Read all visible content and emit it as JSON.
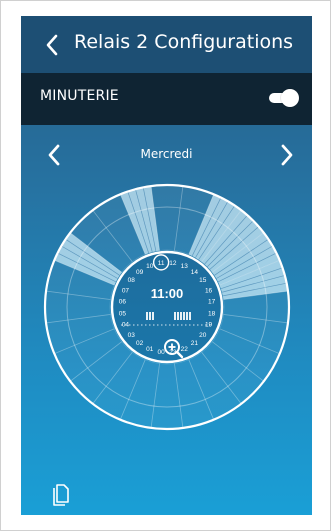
{
  "header": {
    "title": "Relais 2 Configurations",
    "back_icon": "chevron-left-icon"
  },
  "timer": {
    "label": "MINUTERIE",
    "enabled": true
  },
  "day_selector": {
    "day": "Mercredi",
    "prev_icon": "chevron-left-icon",
    "next_icon": "chevron-right-icon"
  },
  "dial": {
    "center_time": "11:00",
    "hours_right": [
      "12",
      "13",
      "14",
      "15",
      "16",
      "17",
      "18",
      "19",
      "20",
      "21",
      "22",
      "23"
    ],
    "hours_left": [
      "00",
      "01",
      "02",
      "03",
      "04",
      "05",
      "06",
      "07",
      "08",
      "09",
      "10",
      "11"
    ],
    "highlighted_hour": "11",
    "active_hours": [
      8,
      11,
      14,
      15,
      16,
      17
    ],
    "zoom_icon": "zoom-in-icon"
  },
  "footer": {
    "copy_icon": "copy-icon"
  },
  "colors": {
    "header_bg": "#1d4f74",
    "timer_bg": "#0f2433",
    "active_segment": "#bfe3f2"
  }
}
